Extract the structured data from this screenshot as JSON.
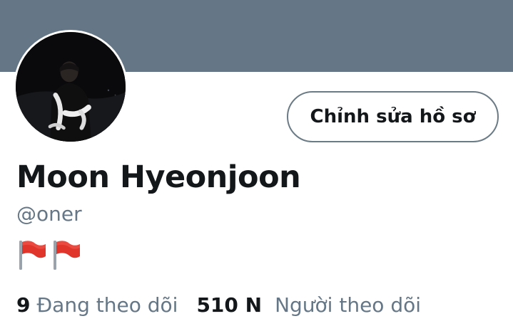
{
  "colors": {
    "banner": "#657786",
    "text_primary": "#14171a",
    "text_secondary": "#657786",
    "button_border": "#6b7b86"
  },
  "profile": {
    "display_name": "Moon Hyeonjoon",
    "handle": "@oner",
    "bio_icons": [
      "red-flag-icon",
      "red-flag-icon"
    ],
    "edit_button_label": "Chỉnh sửa hồ sơ"
  },
  "stats": {
    "following_count": "9",
    "following_label": "Đang theo dõi",
    "followers_count": "510 N",
    "followers_label": "Người theo dõi"
  }
}
